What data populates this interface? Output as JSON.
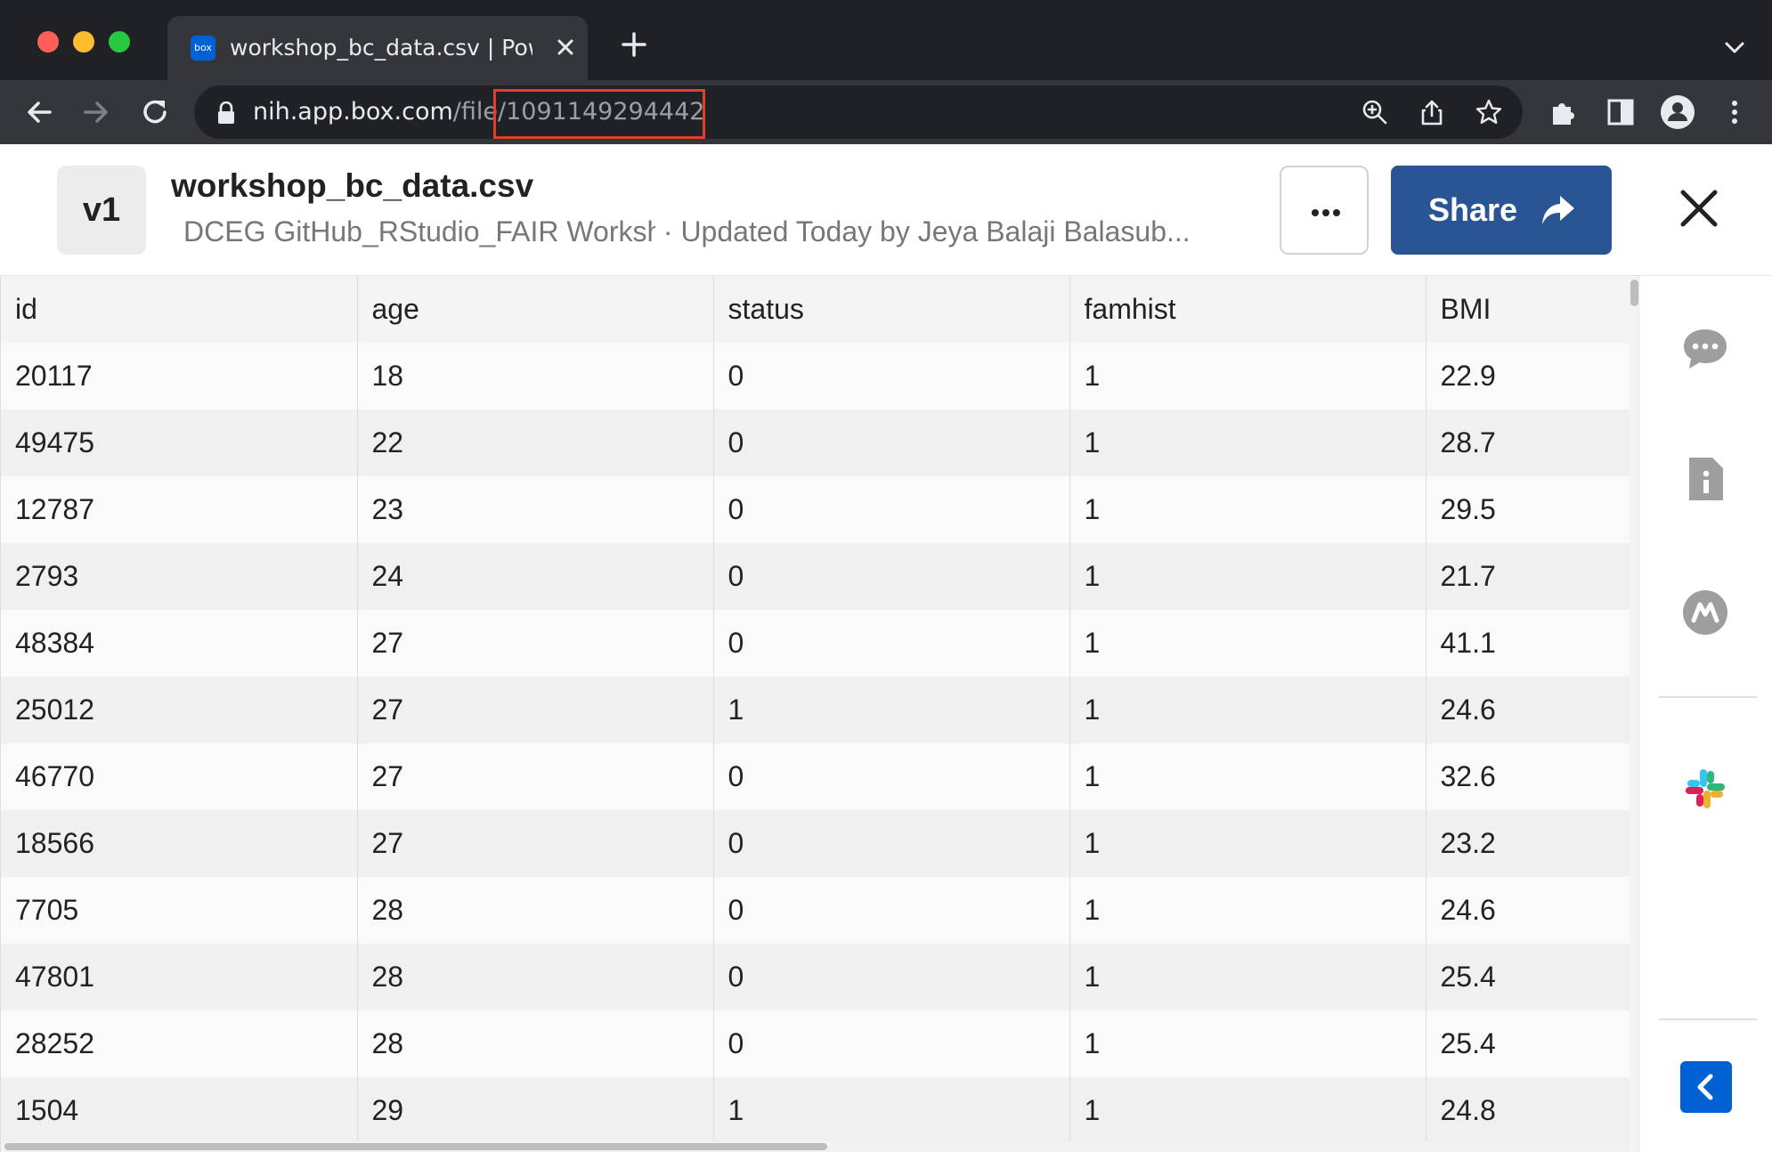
{
  "browser": {
    "tab": {
      "favicon_text": "box",
      "title": "workshop_bc_data.csv | Powered by Box"
    },
    "url": {
      "host": "nih.app.box.com",
      "path": "/file/",
      "file_id": "1091149294442"
    }
  },
  "preview": {
    "version": "v1",
    "file_name": "workshop_bc_data.csv",
    "folder": "DCEG GitHub_RStudio_FAIR Workshop",
    "separator": "·",
    "updated": "Updated Today by Jeya Balaji Balasub...",
    "share_label": "Share"
  },
  "table": {
    "columns": [
      "id",
      "age",
      "status",
      "famhist",
      "BMI"
    ],
    "rows": [
      [
        "20117",
        "18",
        "0",
        "1",
        "22.9"
      ],
      [
        "49475",
        "22",
        "0",
        "1",
        "28.7"
      ],
      [
        "12787",
        "23",
        "0",
        "1",
        "29.5"
      ],
      [
        "2793",
        "24",
        "0",
        "1",
        "21.7"
      ],
      [
        "48384",
        "27",
        "0",
        "1",
        "41.1"
      ],
      [
        "25012",
        "27",
        "1",
        "1",
        "24.6"
      ],
      [
        "46770",
        "27",
        "0",
        "1",
        "32.6"
      ],
      [
        "18566",
        "27",
        "0",
        "1",
        "23.2"
      ],
      [
        "7705",
        "28",
        "0",
        "1",
        "24.6"
      ],
      [
        "47801",
        "28",
        "0",
        "1",
        "25.4"
      ],
      [
        "28252",
        "28",
        "0",
        "1",
        "25.4"
      ],
      [
        "1504",
        "29",
        "1",
        "1",
        "24.8"
      ]
    ]
  },
  "sidebar": {
    "icons": [
      "comment-icon",
      "file-info-icon",
      "metadata-icon",
      "slack-icon",
      "chevron-left-icon"
    ]
  },
  "colors": {
    "share_button": "#2a5595",
    "highlight_box": "#e0402b",
    "collapse_button": "#0061d5",
    "chrome_dark": "#202124",
    "chrome_toolbar": "#35363a"
  }
}
